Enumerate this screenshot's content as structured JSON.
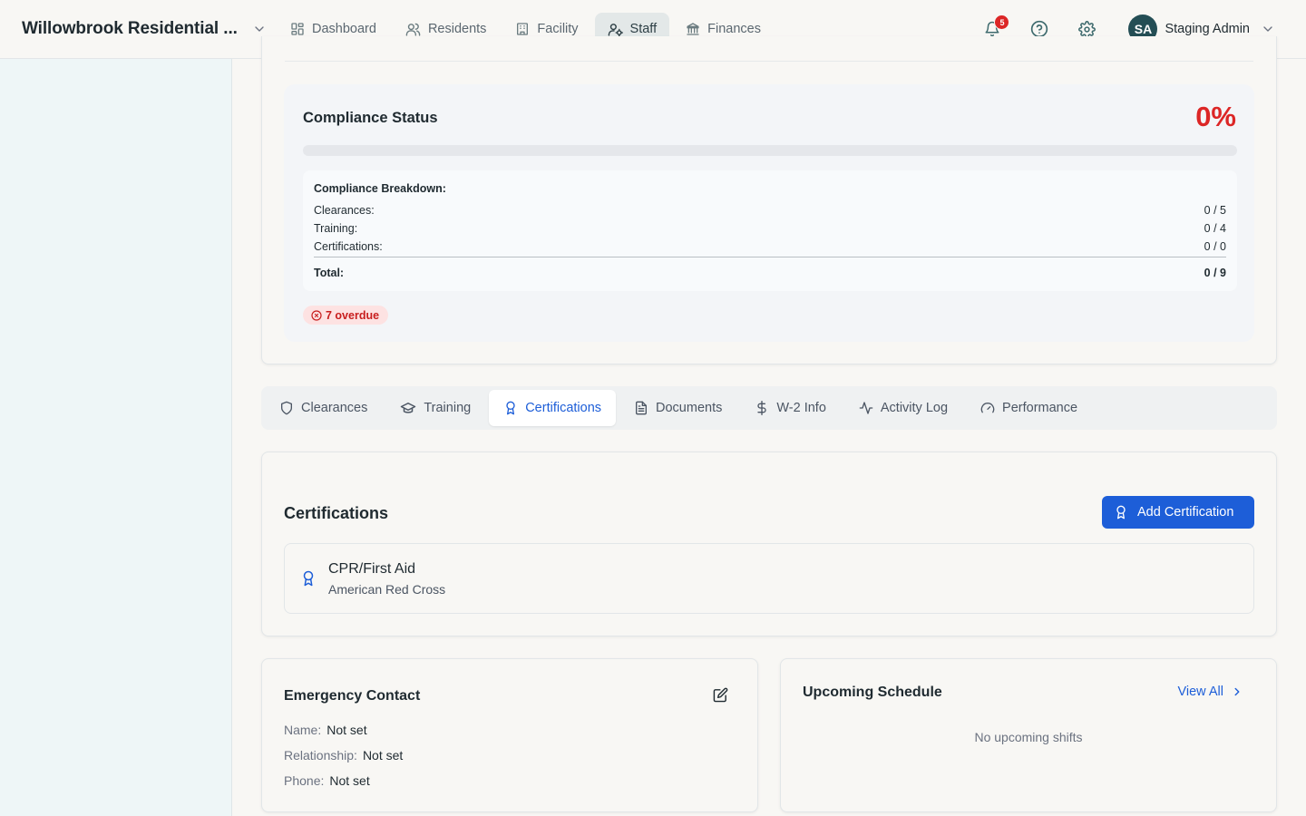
{
  "header": {
    "org_name": "Willowbrook Residential ...",
    "nav": [
      {
        "label": "Dashboard",
        "icon": "dashboard-icon",
        "active": false
      },
      {
        "label": "Residents",
        "icon": "users-icon",
        "active": false
      },
      {
        "label": "Facility",
        "icon": "building-icon",
        "active": false
      },
      {
        "label": "Staff",
        "icon": "staff-icon",
        "active": true
      },
      {
        "label": "Finances",
        "icon": "bank-icon",
        "active": false
      }
    ],
    "notification_count": "5",
    "user": {
      "initials": "SA",
      "name": "Staging Admin"
    }
  },
  "compliance": {
    "title": "Compliance Status",
    "percent_label": "0%",
    "progress": 0,
    "breakdown_title": "Compliance Breakdown:",
    "rows": [
      {
        "label": "Clearances:",
        "value": "0 / 5"
      },
      {
        "label": "Training:",
        "value": "0 / 4"
      },
      {
        "label": "Certifications:",
        "value": "0 / 0"
      }
    ],
    "total": {
      "label": "Total:",
      "value": "0 / 9"
    },
    "overdue": "7 overdue"
  },
  "tabs": [
    {
      "label": "Clearances",
      "icon": "shield-icon",
      "active": false
    },
    {
      "label": "Training",
      "icon": "graduation-cap-icon",
      "active": false
    },
    {
      "label": "Certifications",
      "icon": "award-icon",
      "active": true
    },
    {
      "label": "Documents",
      "icon": "document-icon",
      "active": false
    },
    {
      "label": "W-2 Info",
      "icon": "dollar-icon",
      "active": false
    },
    {
      "label": "Activity Log",
      "icon": "activity-icon",
      "active": false
    },
    {
      "label": "Performance",
      "icon": "gauge-icon",
      "active": false
    }
  ],
  "certifications": {
    "title": "Certifications",
    "add_label": "Add Certification",
    "items": [
      {
        "name": "CPR/First Aid",
        "issuer": "American Red Cross"
      }
    ]
  },
  "emergency_contact": {
    "title": "Emergency Contact",
    "rows": [
      {
        "label": "Name:",
        "value": "Not set"
      },
      {
        "label": "Relationship:",
        "value": "Not set"
      },
      {
        "label": "Phone:",
        "value": "Not set"
      }
    ]
  },
  "schedule": {
    "title": "Upcoming Schedule",
    "view_all": "View All",
    "empty": "No upcoming shifts"
  },
  "colors": {
    "accent": "#1d5ed8",
    "danger": "#dc2626",
    "avatar": "#244e55",
    "sidebar": "#eef6f7"
  }
}
